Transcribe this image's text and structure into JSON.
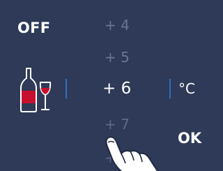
{
  "off_button": {
    "label": "OFF"
  },
  "ok_button": {
    "label": "OK"
  },
  "temperature_picker": {
    "items": [
      "+ 4",
      "+ 5",
      "+ 6",
      "+ 7",
      "+"
    ],
    "selected": "+ 6",
    "unit": "°C"
  },
  "icons": {
    "wine": "wine-bottle-and-glass-icon",
    "pointer": "pointing-hand-icon"
  },
  "colors": {
    "background": "#2e3a57",
    "accent_divider": "#2f6fc4",
    "wine_red": "#c8102e",
    "dim_text": "#6b7590"
  }
}
